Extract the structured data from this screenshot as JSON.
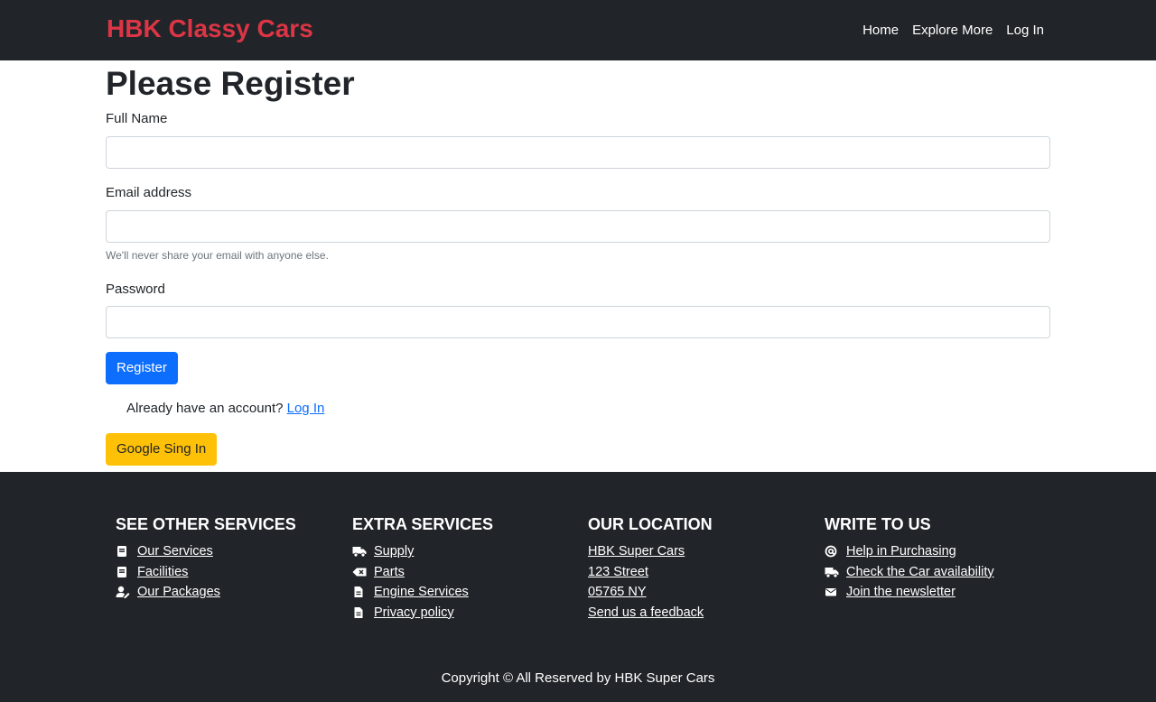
{
  "navbar": {
    "brand": "HBK Classy Cars",
    "links": [
      "Home",
      "Explore More",
      "Log In"
    ]
  },
  "form": {
    "title": "Please Register",
    "full_name_label": "Full Name",
    "full_name_value": "",
    "email_label": "Email address",
    "email_value": "",
    "email_help": "We'll never share your email with anyone else.",
    "password_label": "Password",
    "password_value": "",
    "register_button": "Register",
    "already_text": "Already have an account?",
    "login_link": "Log In",
    "google_button": "Google Sing In"
  },
  "footer": {
    "columns": [
      {
        "title": "SEE OTHER SERVICES",
        "items": [
          {
            "label": "Our Services",
            "icon": "book-icon"
          },
          {
            "label": "Facilities",
            "icon": "book-icon"
          },
          {
            "label": "Our Packages",
            "icon": "user-edit-icon"
          }
        ]
      },
      {
        "title": "EXTRA SERVICES",
        "items": [
          {
            "label": "Supply",
            "icon": "truck-icon"
          },
          {
            "label": "Parts",
            "icon": "backspace-icon"
          },
          {
            "label": "Engine Services",
            "icon": "file-icon"
          },
          {
            "label": "Privacy policy",
            "icon": "file-icon"
          }
        ]
      },
      {
        "title": "OUR LOCATION",
        "items": [
          {
            "label": "HBK Super Cars"
          },
          {
            "label": "123 Street"
          },
          {
            "label": "05765 NY"
          },
          {
            "label": "Send us a feedback"
          }
        ]
      },
      {
        "title": "WRITE TO US",
        "items": [
          {
            "label": "Help in Purchasing",
            "icon": "at-icon"
          },
          {
            "label": "Check the Car availability",
            "icon": "truck-icon"
          },
          {
            "label": "Join the newsletter",
            "icon": "envelope-icon"
          }
        ]
      }
    ],
    "copyright": "Copyright © All Reserved by HBK Super Cars"
  },
  "colors": {
    "dark": "#212529",
    "brand": "#dc3545",
    "primary": "#0d6efd",
    "warning": "#ffc107"
  }
}
